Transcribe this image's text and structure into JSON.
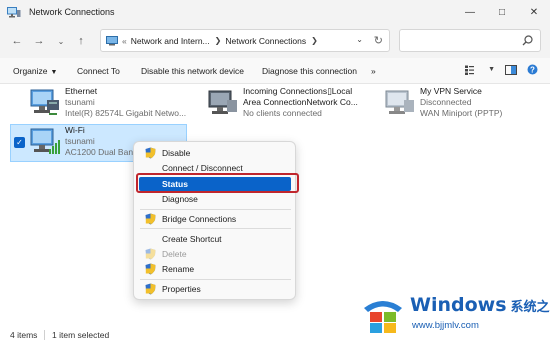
{
  "window": {
    "title": "Network Connections",
    "controls": [
      "minimize",
      "maximize",
      "close"
    ]
  },
  "address_bar": {
    "overflow": "«",
    "segments": [
      "Network and Intern...",
      "Network Connections"
    ],
    "search_placeholder": ""
  },
  "commands": {
    "organize": "Organize",
    "connect_to": "Connect To",
    "disable_device": "Disable this network device",
    "diagnose": "Diagnose this connection",
    "more": "»"
  },
  "connections": [
    {
      "name": "Ethernet",
      "network": "tsunami",
      "device": "Intel(R) 82574L Gigabit Netwo..."
    },
    {
      "name": "Incoming Connections▯Local",
      "network": "Area ConnectionNetwork Co...",
      "device": "No clients connected"
    },
    {
      "name": "My VPN Service",
      "network": "Disconnected",
      "device": "WAN Miniport (PPTP)"
    },
    {
      "name": "Wi-Fi",
      "network": "tsunami",
      "device": "AC1200  Dual Band"
    }
  ],
  "context_menu": {
    "items": [
      {
        "label": "Disable",
        "shield": true,
        "disabled": false
      },
      {
        "label": "Connect / Disconnect",
        "shield": false,
        "disabled": false
      },
      {
        "label": "Status",
        "shield": false,
        "disabled": false,
        "highlighted": true
      },
      {
        "label": "Diagnose",
        "shield": false,
        "disabled": false
      },
      {
        "label": "Bridge Connections",
        "shield": true,
        "disabled": false
      },
      {
        "label": "Create Shortcut",
        "shield": false,
        "disabled": false
      },
      {
        "label": "Delete",
        "shield": true,
        "disabled": true
      },
      {
        "label": "Rename",
        "shield": true,
        "disabled": false
      },
      {
        "label": "Properties",
        "shield": true,
        "disabled": false
      }
    ]
  },
  "status_bar": {
    "item_count": "4 items",
    "selection": "1 item selected"
  },
  "watermark": {
    "brand": "Windows",
    "brand_cn": "系统之家",
    "url": "www.bjjmlv.com"
  },
  "colors": {
    "accent": "#0a63c9",
    "selection_bg": "#cce8ff",
    "highlight_border": "#c0262d",
    "watermark_blue": "#1a5fb4"
  }
}
